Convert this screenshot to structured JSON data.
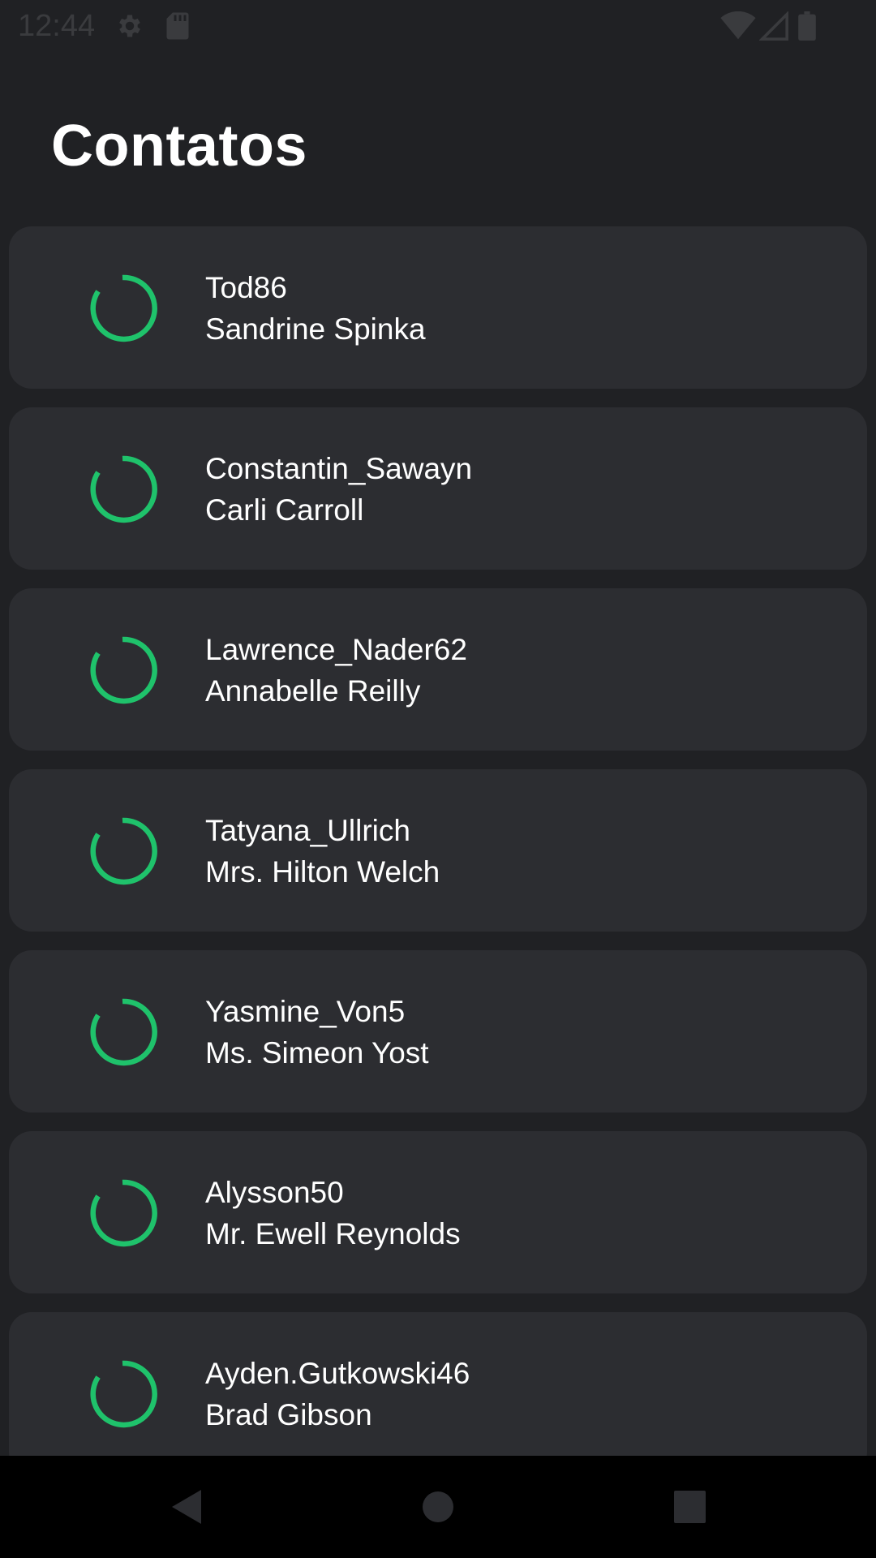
{
  "status_bar": {
    "time": "12:44",
    "icons": [
      "gear-icon",
      "sd-card-icon",
      "wifi-icon",
      "signal-icon",
      "battery-icon"
    ]
  },
  "header": {
    "title": "Contatos"
  },
  "theme": {
    "background": "#202124",
    "card": "#2c2d31",
    "spinner_accent": "#1fc26b",
    "text": "#ffffff"
  },
  "contacts": [
    {
      "username": "Tod86",
      "name": "Sandrine Spinka"
    },
    {
      "username": "Constantin_Sawayn",
      "name": "Carli Carroll"
    },
    {
      "username": "Lawrence_Nader62",
      "name": "Annabelle Reilly"
    },
    {
      "username": "Tatyana_Ullrich",
      "name": "Mrs. Hilton Welch"
    },
    {
      "username": "Yasmine_Von5",
      "name": "Ms. Simeon Yost"
    },
    {
      "username": "Alysson50",
      "name": "Mr. Ewell Reynolds"
    },
    {
      "username": "Ayden.Gutkowski46",
      "name": "Brad Gibson"
    }
  ],
  "nav_bar": {
    "icons": [
      "back-icon",
      "home-icon",
      "recents-icon"
    ]
  }
}
